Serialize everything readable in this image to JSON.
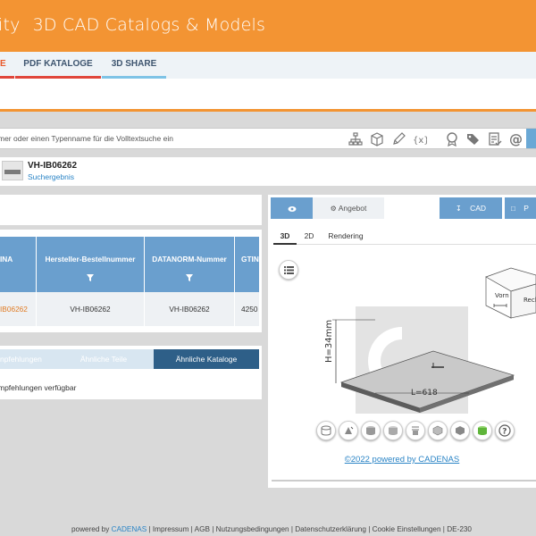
{
  "header": {
    "brand_partial": "ity",
    "title": "3D CAD Catalogs & Models"
  },
  "nav": {
    "tabs": [
      {
        "label": "E"
      },
      {
        "label": "PDF KATALOGE"
      },
      {
        "label": "3D SHARE"
      }
    ]
  },
  "search": {
    "placeholder": "mer oder einen Typenname für die Volltextsuche ein"
  },
  "result": {
    "part_number": "VH-IB06262",
    "subtitle": "Suchergebnis"
  },
  "table": {
    "headers": [
      {
        "label": "INA"
      },
      {
        "label": "Hersteller-Bestellnummer"
      },
      {
        "label": "DATANORM-Nummer"
      },
      {
        "label": "GTIN"
      }
    ],
    "row": [
      "IB06262",
      "VH-IB06262",
      "VH-IB06262",
      "4250"
    ]
  },
  "recommendations": {
    "tabs": [
      {
        "label": "npfehlungen"
      },
      {
        "label": "Ähnliche Teile"
      },
      {
        "label": "Ähnliche Kataloge"
      }
    ],
    "empty_text": "mpfehlungen verfügbar"
  },
  "viewer": {
    "tabs": {
      "angebot": "Angebot",
      "cad": "CAD",
      "pdf": "P"
    },
    "subtabs": [
      {
        "label": "3D"
      },
      {
        "label": "2D"
      },
      {
        "label": "Rendering"
      }
    ],
    "dim_height": "H=34mm",
    "dim_length": "L=618",
    "cube_front": "Vorn",
    "cube_right": "Rech",
    "powered_link": "©2022 powered by CADENAS"
  },
  "footer": {
    "prefix": "powered by",
    "brand": "CADENAS",
    "links": [
      "Impressum",
      "AGB",
      "Nutzungsbedingungen",
      "Datenschutzerklärung",
      "Cookie Einstellungen",
      "DE-230"
    ]
  }
}
